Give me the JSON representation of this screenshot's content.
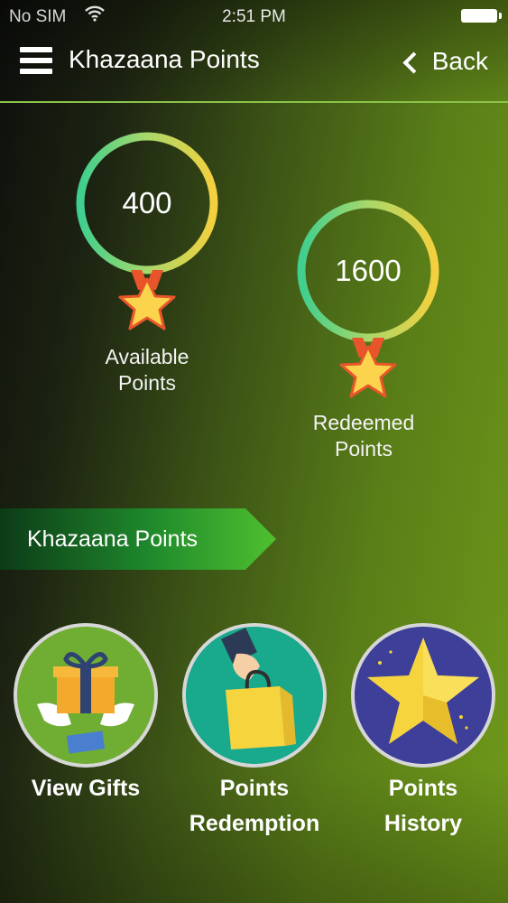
{
  "status_bar": {
    "carrier": "No SIM",
    "time": "2:51 PM"
  },
  "nav": {
    "title": "Khazaana Points",
    "back_label": "Back",
    "menu_icon": "hamburger-menu-icon"
  },
  "medals": [
    {
      "value": "400",
      "label_line1": "Available",
      "label_line2": "Points"
    },
    {
      "value": "1600",
      "label_line1": "Redeemed",
      "label_line2": "Points"
    }
  ],
  "banner": {
    "label": "Khazaana Points"
  },
  "actions": [
    {
      "label_line1": "View Gifts",
      "label_line2": "",
      "icon": "gift-icon"
    },
    {
      "label_line1": "Points",
      "label_line2": "Redemption",
      "icon": "shopping-bag-icon"
    },
    {
      "label_line1": "Points",
      "label_line2": "History",
      "icon": "star-icon"
    }
  ],
  "colors": {
    "accent_green": "#8bc34a",
    "ring_start": "#3fcf8e",
    "ring_end": "#f4d03f",
    "star": "#f9d14b"
  }
}
